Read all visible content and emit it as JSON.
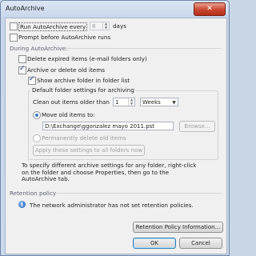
{
  "window": {
    "title": "AutoArchive",
    "close_glyph": "✕"
  },
  "autoarchive": {
    "run_label": "Run AutoArchive every",
    "run_checked": false,
    "days_value": "8",
    "days_unit": "days",
    "prompt_label": "Prompt before AutoArchive runs",
    "prompt_checked": false
  },
  "during": {
    "header": "During AutoArchive:",
    "delete_expired_label": "Delete expired items (e-mail folders only)",
    "delete_expired_checked": false,
    "archive_label": "Archive or delete old items",
    "archive_checked": true,
    "show_folder_label": "Show archive folder in folder list",
    "show_folder_checked": true
  },
  "defaults": {
    "group_title": "Default folder settings for archiving",
    "clean_label": "Clean out items older than",
    "clean_value": "1",
    "period_value": "Weeks",
    "move_label": "Move old items to:",
    "move_selected": true,
    "path_value": "D:\\Exchange\\ggonzalez mayo 2011.pst",
    "browse_label": "Browse...",
    "perm_delete_label": "Permanently delete old items",
    "perm_delete_selected": false,
    "apply_label": "Apply these settings to all folders now"
  },
  "help_text": [
    "To specify different archive settings for any folder, right-click",
    "on the folder and choose Properties, then go to the",
    "AutoArchive tab."
  ],
  "retention": {
    "header": "Retention policy",
    "message": "The network administrator has not set retention policies.",
    "info_button": "Retention Policy Information..."
  },
  "footer": {
    "ok_label": "OK",
    "cancel_label": "Cancel"
  }
}
